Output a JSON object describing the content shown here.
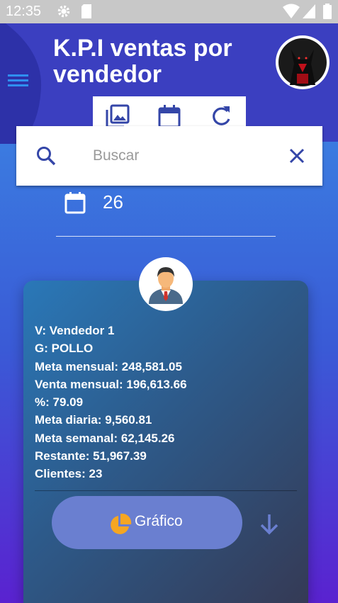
{
  "status_bar": {
    "time": "12:35"
  },
  "header": {
    "title": "K.P.I ventas por vendedor"
  },
  "search": {
    "placeholder": "Buscar",
    "value": ""
  },
  "date_filter": {
    "value": "26"
  },
  "seller_card": {
    "lines": [
      "V: Vendedor 1",
      "G: POLLO",
      "Meta mensual: 248,581.05",
      "Venta mensual: 196,613.66",
      "%: 79.09",
      "Meta diaria: 9,560.81",
      "Meta semanal: 62,145.26",
      "Restante: 51,967.39",
      "Clientes: 23"
    ],
    "chart_button_label": "Gráfico"
  },
  "colors": {
    "accent_blue": "#3b3fc0",
    "icon_blue": "#3446a8",
    "pie_orange": "#f5a623"
  }
}
